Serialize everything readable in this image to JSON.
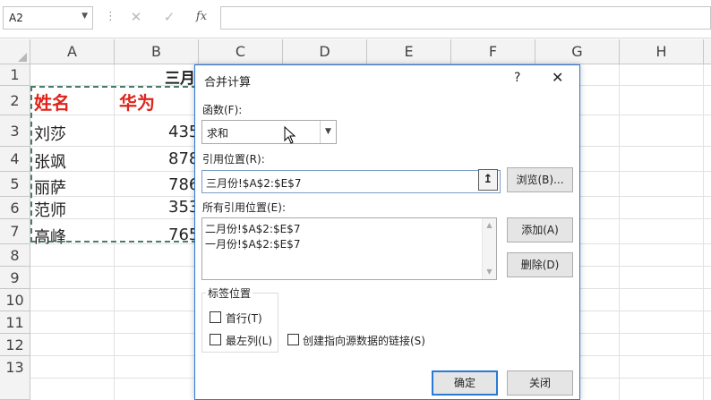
{
  "formula_bar": {
    "name_box": "A2",
    "cancel_icon": "✕",
    "enter_icon": "✓",
    "fx_label": "fx",
    "formula": ""
  },
  "columns": [
    "A",
    "B",
    "C",
    "D",
    "E",
    "F",
    "G",
    "H"
  ],
  "rows": [
    "1",
    "2",
    "3",
    "4",
    "5",
    "6",
    "7",
    "8",
    "9",
    "10",
    "11",
    "12",
    "13"
  ],
  "sheet": {
    "title_partial": "三月",
    "header_name": "姓名",
    "header_huawei": "华为",
    "names": [
      "刘莎",
      "张飒",
      "丽萨",
      "范师",
      "高峰"
    ],
    "values": [
      "435",
      "878",
      "786",
      "353",
      "765"
    ]
  },
  "dialog": {
    "title": "合并计算",
    "help": "?",
    "close": "✕",
    "function_label": "函数(F):",
    "function_value": "求和",
    "reference_label": "引用位置(R):",
    "reference_value": "三月份!$A$2:$E$7",
    "browse_button": "浏览(B)...",
    "all_refs_label": "所有引用位置(E):",
    "all_refs": [
      "二月份!$A$2:$E$7",
      "一月份!$A$2:$E$7"
    ],
    "add_button": "添加(A)",
    "delete_button": "删除(D)",
    "labels_group": "标签位置",
    "top_row": "首行(T)",
    "left_column": "最左列(L)",
    "create_links": "创建指向源数据的链接(S)",
    "ok_button": "确定",
    "close_button": "关闭"
  }
}
